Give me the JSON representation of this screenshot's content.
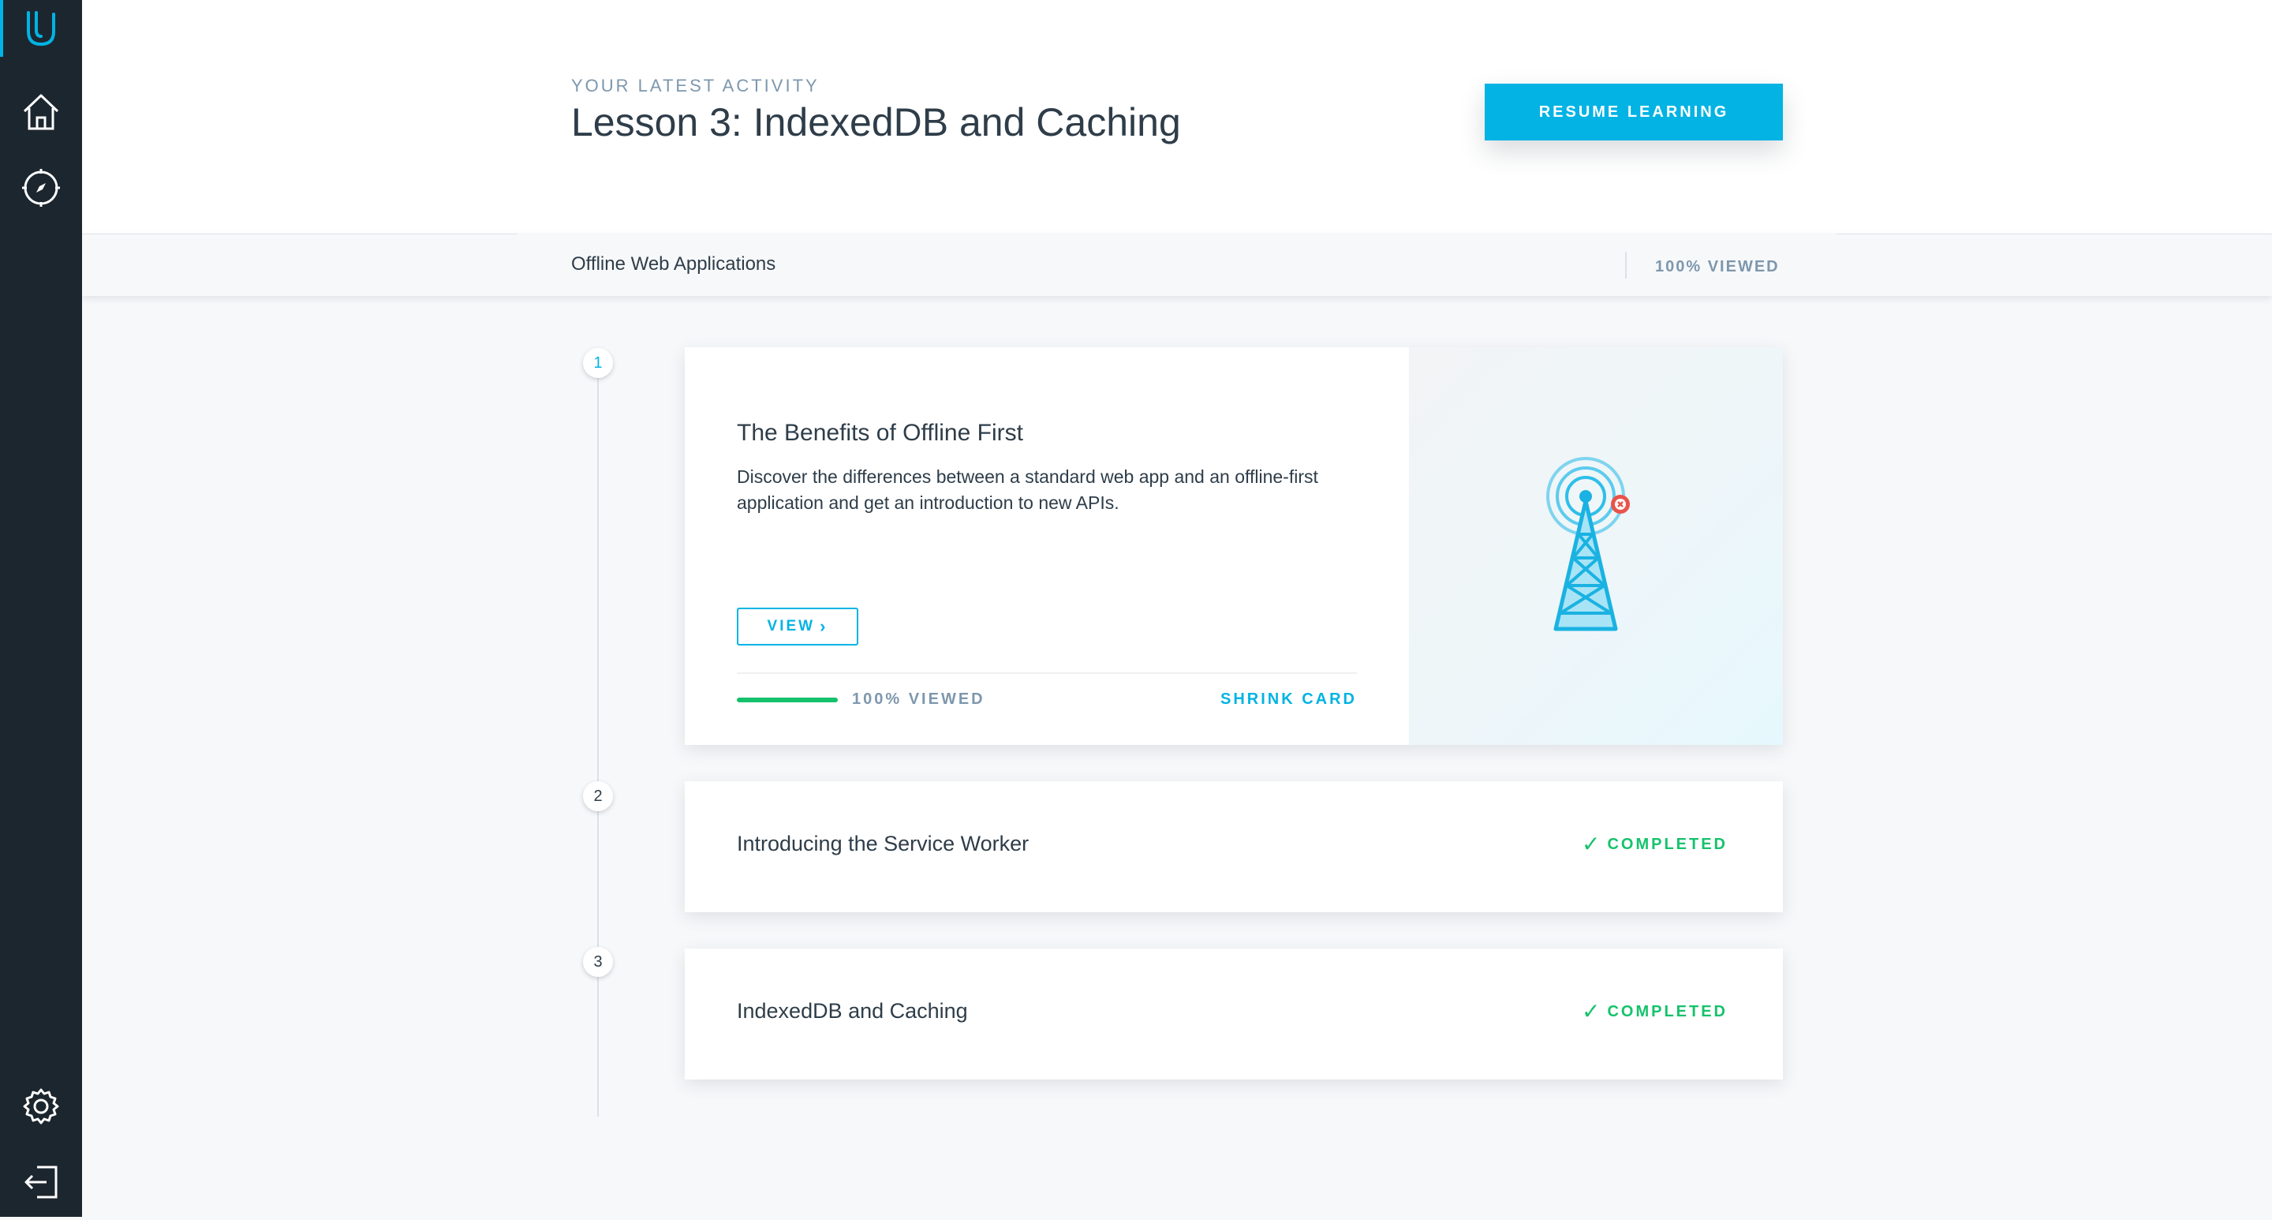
{
  "sidebar": {
    "icons": [
      "udacity-logo-icon",
      "home-icon",
      "compass-icon",
      "settings-icon",
      "logout-icon"
    ]
  },
  "header": {
    "eyebrow": "YOUR LATEST ACTIVITY",
    "title": "Lesson 3: IndexedDB and Caching",
    "resume_label": "RESUME LEARNING"
  },
  "subbar": {
    "course": "Offline Web Applications",
    "viewed": "100% VIEWED"
  },
  "lessons": [
    {
      "num": "1",
      "title": "The Benefits of Offline First",
      "description": "Discover the differences between a standard web app and an offline-first application and get an introduction to new APIs.",
      "view_label": "VIEW",
      "progress_fraction": 1.0,
      "progress_label": "100% VIEWED",
      "shrink_label": "SHRINK CARD",
      "art_icon": "offline-tower-icon"
    },
    {
      "num": "2",
      "title": "Introducing the Service Worker",
      "status": "COMPLETED"
    },
    {
      "num": "3",
      "title": "IndexedDB and Caching",
      "status": "COMPLETED"
    }
  ],
  "colors": {
    "accent": "#02b3e4",
    "success": "#15c26b",
    "sidebar": "#1c262f",
    "error": "#e9534a"
  }
}
